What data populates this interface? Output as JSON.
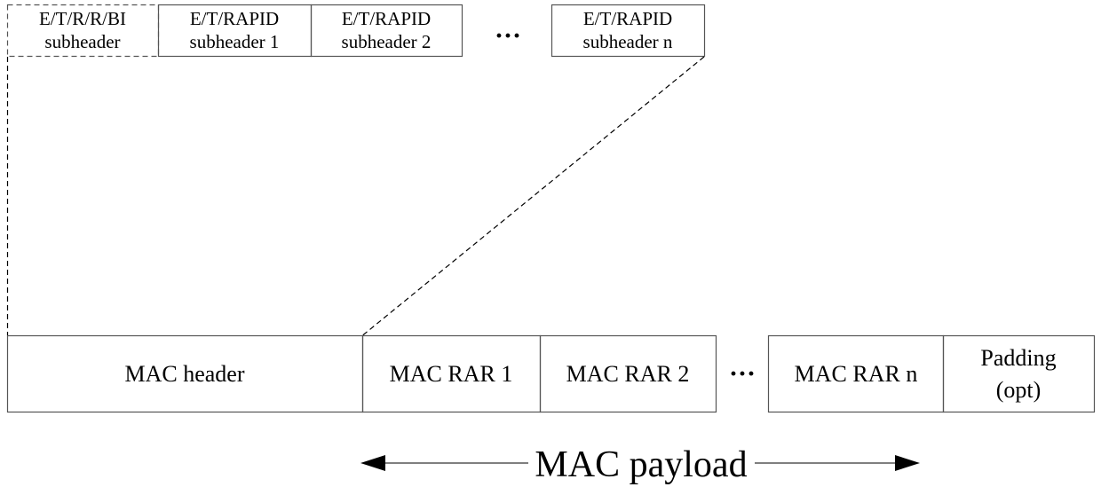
{
  "subheaders": [
    {
      "line1": "E/T/R/R/BI",
      "line2": "subheader",
      "dashed": true
    },
    {
      "line1": "E/T/RAPID",
      "line2": "subheader 1",
      "dashed": false
    },
    {
      "line1": "E/T/RAPID",
      "line2": "subheader 2",
      "dashed": false
    },
    {
      "line1": "E/T/RAPID",
      "line2": "subheader n",
      "dashed": false
    }
  ],
  "subheader_ellipsis": "···",
  "pdu_fields": [
    {
      "line1": "MAC header",
      "line2": ""
    },
    {
      "line1": "MAC RAR 1",
      "line2": ""
    },
    {
      "line1": "MAC RAR 2",
      "line2": ""
    },
    {
      "line1": "MAC RAR n",
      "line2": ""
    },
    {
      "line1": "Padding",
      "line2": "(opt)"
    }
  ],
  "pdu_ellipsis": "···",
  "payload_label": "MAC payload",
  "colors": {
    "stroke": "#555555",
    "text": "#000000",
    "background": "#ffffff"
  }
}
